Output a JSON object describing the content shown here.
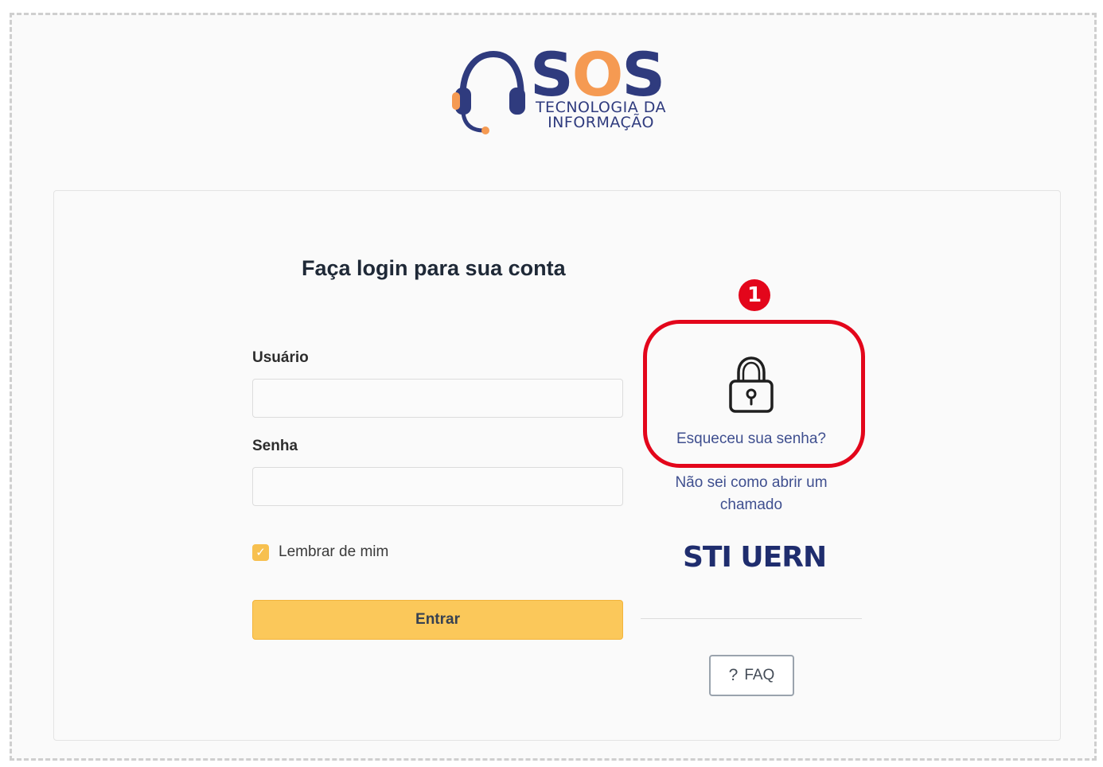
{
  "logo": {
    "brand_name": "SOS",
    "brand_part1": "S",
    "brand_part2": "O",
    "brand_part3": "S",
    "subtitle_line1": "TECNOLOGIA DA",
    "subtitle_line2": "INFORMAÇÃO",
    "icon": "headset-icon",
    "colors": {
      "navy": "#2f3b7e",
      "orange": "#f59a52"
    }
  },
  "login": {
    "title": "Faça login para sua conta",
    "username_label": "Usuário",
    "username_value": "",
    "password_label": "Senha",
    "password_value": "",
    "remember_label": "Lembrar de mim",
    "remember_checked": true,
    "submit_label": "Entrar"
  },
  "side": {
    "lock_icon": "lock-icon",
    "forgot_password": "Esqueceu sua senha?",
    "howto_line1": "Não sei como abrir um",
    "howto_line2": "chamado",
    "org_logo": "STI UERN",
    "faq_icon": "question-icon",
    "faq_label": "FAQ"
  },
  "annotation": {
    "step_number": "1",
    "color": "#e3061b"
  },
  "colors": {
    "accent": "#fbc85a",
    "link": "#3f4f8f"
  }
}
